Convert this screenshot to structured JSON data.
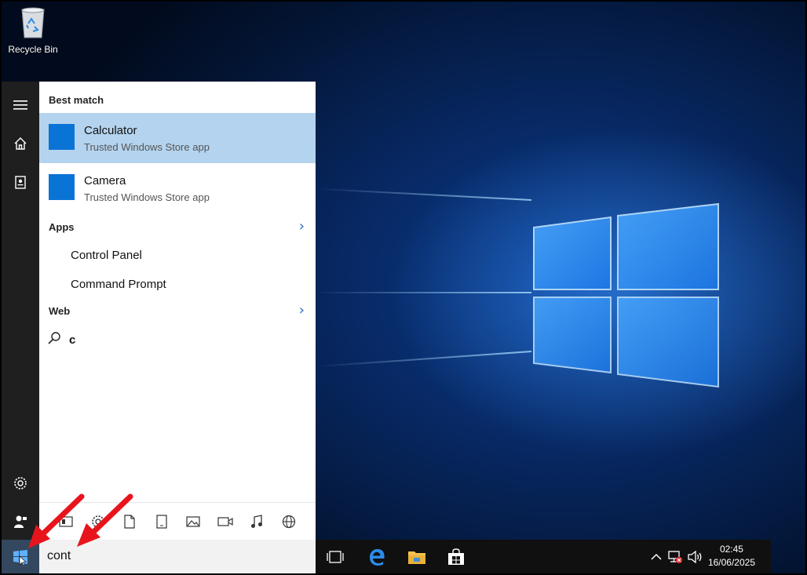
{
  "desktop": {
    "recycle_bin_label": "Recycle Bin"
  },
  "rail": {
    "items": [
      "menu-icon",
      "home-icon",
      "notebook-icon",
      "settings-icon",
      "feedback-icon"
    ]
  },
  "results": {
    "best_match_heading": "Best match",
    "best": [
      {
        "name": "Calculator",
        "sub": "Trusted Windows Store app",
        "selected": true
      },
      {
        "name": "Camera",
        "sub": "Trusted Windows Store app",
        "selected": false
      }
    ],
    "apps_heading": "Apps",
    "apps": [
      "Control Panel",
      "Command Prompt"
    ],
    "web_heading": "Web",
    "web_query": "c"
  },
  "filters": [
    "apps-filter-icon",
    "settings-filter-icon",
    "documents-filter-icon",
    "tablet-filter-icon",
    "photos-filter-icon",
    "videos-filter-icon",
    "music-filter-icon",
    "web-filter-icon"
  ],
  "search": {
    "value": "cont"
  },
  "taskbar": {
    "apps": [
      "task-view-icon",
      "edge-icon",
      "file-explorer-icon",
      "store-icon"
    ]
  },
  "clock": {
    "time": "02:45",
    "date": "16/06/2025"
  },
  "colors": {
    "accent": "#0a74d6",
    "selection": "#b4d3ee",
    "annotation_arrow": "#e8141c"
  }
}
